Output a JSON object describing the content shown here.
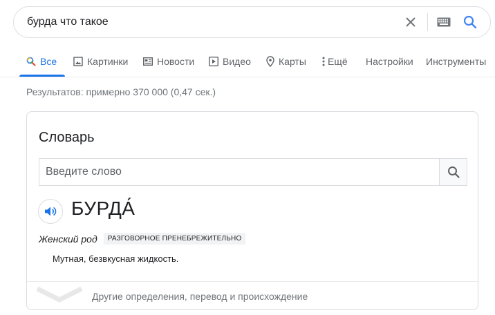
{
  "search": {
    "query": "бурда что такое"
  },
  "tabs": [
    {
      "label": "Все",
      "icon": "search-icon",
      "active": true
    },
    {
      "label": "Картинки",
      "icon": "image-icon",
      "active": false
    },
    {
      "label": "Новости",
      "icon": "news-icon",
      "active": false
    },
    {
      "label": "Видео",
      "icon": "play-icon",
      "active": false
    },
    {
      "label": "Карты",
      "icon": "map-pin-icon",
      "active": false
    },
    {
      "label": "Ещё",
      "icon": "more-vert-icon",
      "active": false
    },
    {
      "label": "Настройки",
      "icon": "",
      "active": false
    },
    {
      "label": "Инструменты",
      "icon": "",
      "active": false
    }
  ],
  "result_stats": "Результатов: примерно 370 000 (0,47 сек.) ",
  "dictionary": {
    "title": "Словарь",
    "input_placeholder": "Введите слово",
    "headword": "БУРДА́",
    "gender": "Женский род",
    "label": "РАЗГОВОРНОЕ ПРЕНЕБРЕЖИТЕЛЬНО",
    "definition": "Мутная, безвкусная жидкость.",
    "more_link": "Другие определения, перевод и происхождение"
  },
  "colors": {
    "accent": "#1a73e8",
    "text": "#202124",
    "muted": "#70757a",
    "border": "#dadce0"
  }
}
